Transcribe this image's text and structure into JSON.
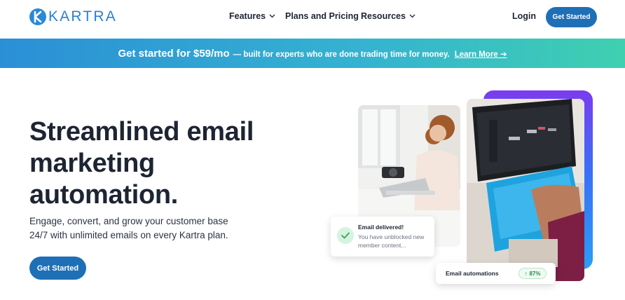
{
  "nav": {
    "logo_text": "KARTRA",
    "links": [
      {
        "label": "Features",
        "has_dropdown": true
      },
      {
        "label": "Plans and Pricing",
        "has_dropdown": false
      },
      {
        "label": "Resources",
        "has_dropdown": true
      }
    ],
    "login_label": "Login",
    "cta_label": "Get Started"
  },
  "banner": {
    "headline": "Get started for $59/mo",
    "subtext": "— built for experts who are done trading time for money.",
    "link_label": "Learn More ➔"
  },
  "hero": {
    "title_lines": [
      "Streamlined email",
      "marketing",
      "automation."
    ],
    "subtitle_lines": [
      "Engage, convert, and grow your customer base",
      "24/7 with unlimited emails on every Kartra plan."
    ],
    "cta_label": "Get Started"
  },
  "cards": {
    "email_delivered": {
      "title": "Email delivered!",
      "body_lines": [
        "You have unblocked new",
        "member content..."
      ]
    },
    "automations": {
      "label": "Email automations",
      "badge_arrow": "↑",
      "badge_value": "87%"
    }
  },
  "colors": {
    "brand_blue": "#1f6fb7",
    "logo_blue": "#2b7fd0",
    "text_dark": "#1d2433",
    "banner_start": "#2b8fd6",
    "banner_end": "#3fd0b0",
    "success_green": "#2e8a4f"
  },
  "icons": {
    "logo": "kartra-k-icon",
    "dropdown": "chevron-down-icon",
    "success": "check-icon"
  }
}
